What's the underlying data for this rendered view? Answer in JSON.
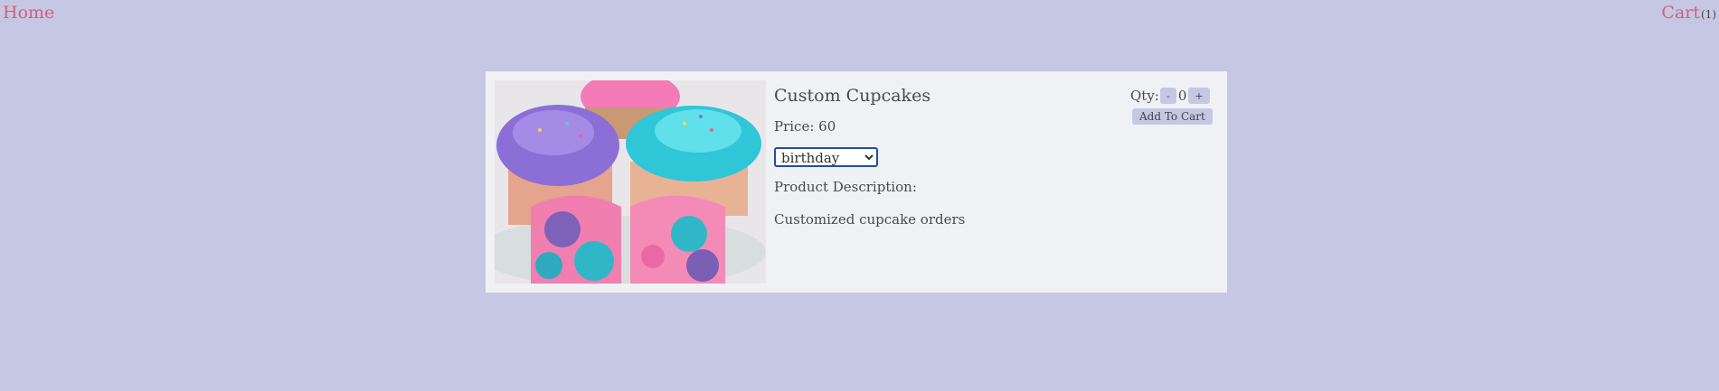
{
  "nav": {
    "home_label": "Home",
    "cart_label": "Cart",
    "cart_count": "(1)"
  },
  "product": {
    "title": "Custom Cupcakes",
    "price_text": "Price: 60",
    "selected_option": "birthday",
    "description_label": "Product Description:",
    "description_text": "Customized cupcake orders"
  },
  "quantity": {
    "label": "Qty:",
    "minus_label": "-",
    "value": "0",
    "plus_label": "+",
    "add_to_cart_label": "Add To Cart"
  },
  "colors": {
    "background": "#c6c8e3",
    "link": "#d0607f",
    "card": "#f0f1f4",
    "button": "#c6c8e3"
  }
}
